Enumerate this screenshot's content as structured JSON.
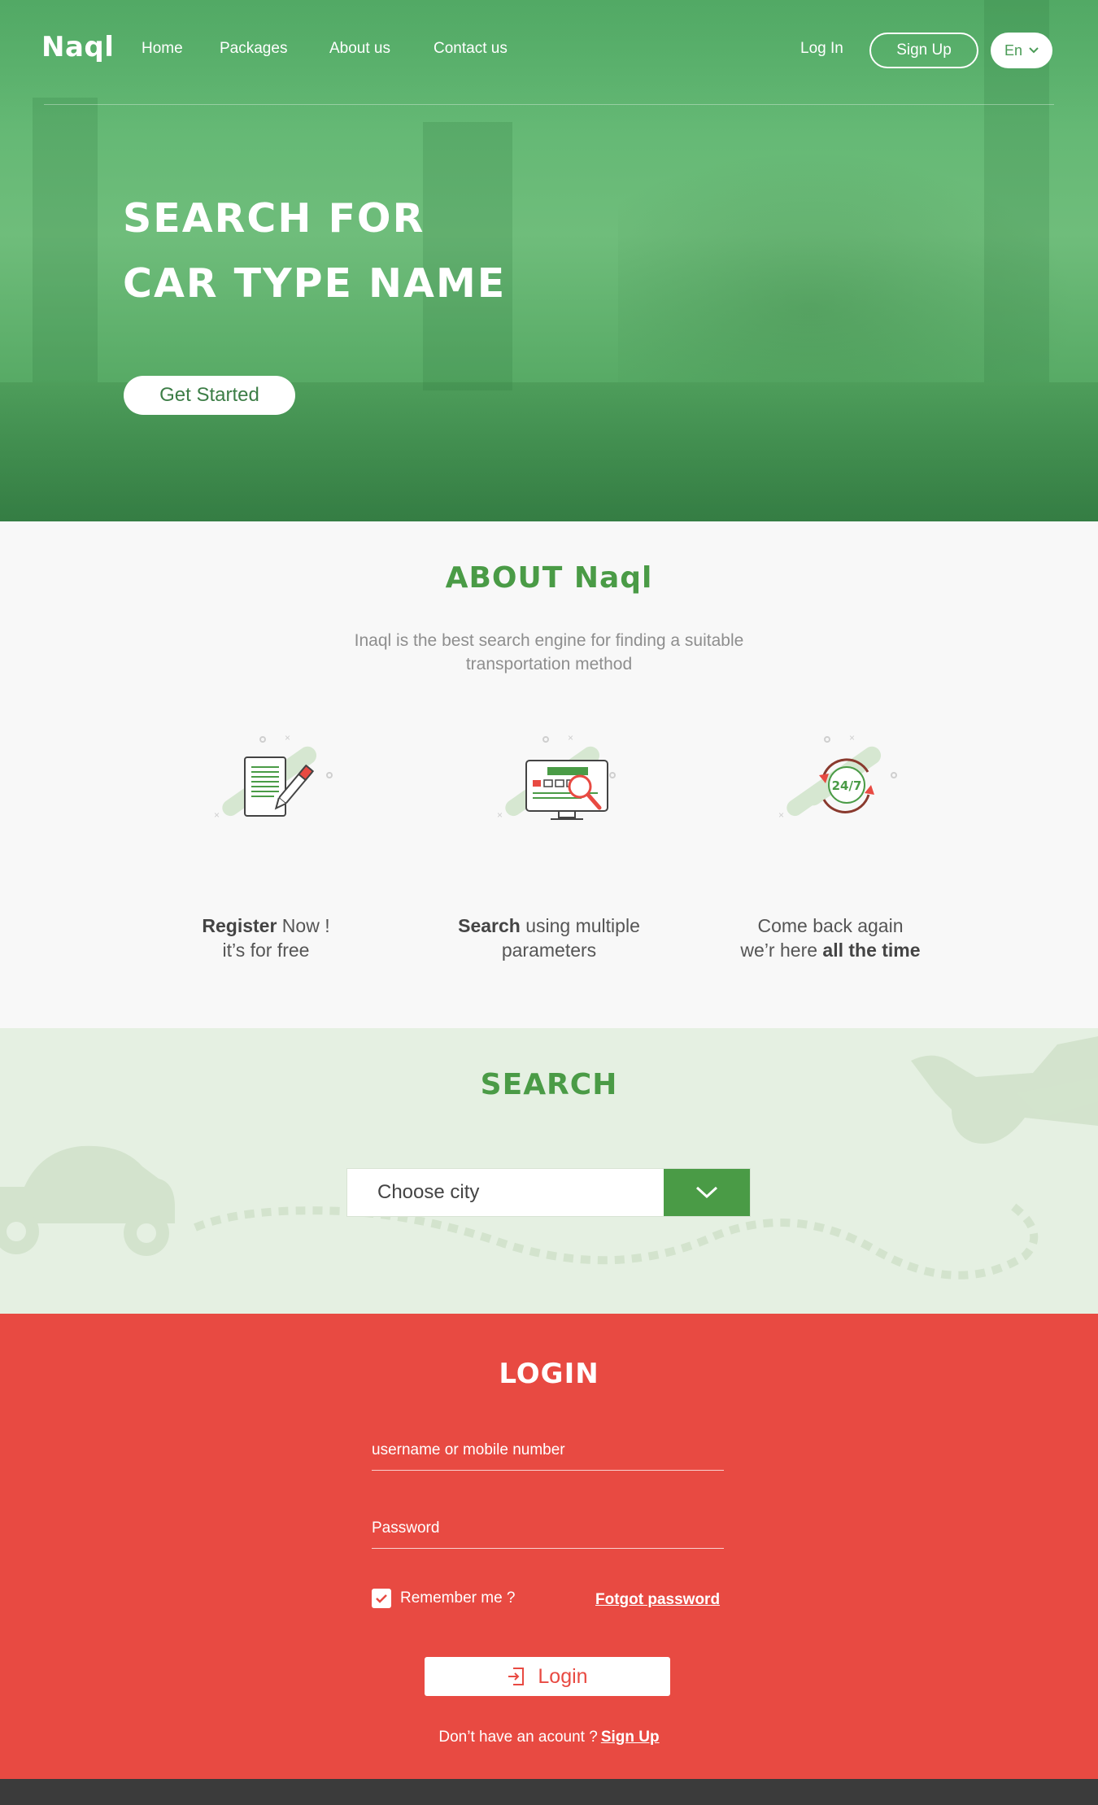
{
  "nav": {
    "logo": "Naql",
    "links": [
      "Home",
      "Packages",
      "About us",
      "Contact us"
    ],
    "login": "Log In",
    "signup": "Sign Up",
    "language": "En"
  },
  "hero": {
    "title_line1": "SEARCH FOR",
    "title_line2": "CAR TYPE NAME",
    "cta": "Get Started"
  },
  "about": {
    "title": "ABOUT Naql",
    "description": "Inaql is the best search engine for finding a suitable transportation method",
    "features": [
      {
        "icon": "register-icon",
        "bold": "Register",
        "rest1": " Now !",
        "line2": "it’s for free"
      },
      {
        "icon": "search-monitor-icon",
        "bold": "Search",
        "rest1": " using multiple",
        "line2": "parameters"
      },
      {
        "icon": "clock-24-7-icon",
        "line1": "Come back again",
        "pre2": "we’r here ",
        "bold2": "all the time",
        "badge": "24/7"
      }
    ]
  },
  "search": {
    "title": "SEARCH",
    "select_label": "Choose city"
  },
  "login": {
    "title": "LOGIN",
    "username_placeholder": "username or mobile number",
    "password_placeholder": "Password",
    "remember": "Remember me ?",
    "forgot": "Fotgot password",
    "button": "Login",
    "no_account": "Don’t have an acount ?",
    "signup": "Sign Up"
  },
  "colors": {
    "brand_green": "#4a9b46",
    "hero_green": "#58b36d",
    "login_red": "#e84a42",
    "search_bg": "#e5f0e2",
    "footer": "#3b3b3b"
  }
}
